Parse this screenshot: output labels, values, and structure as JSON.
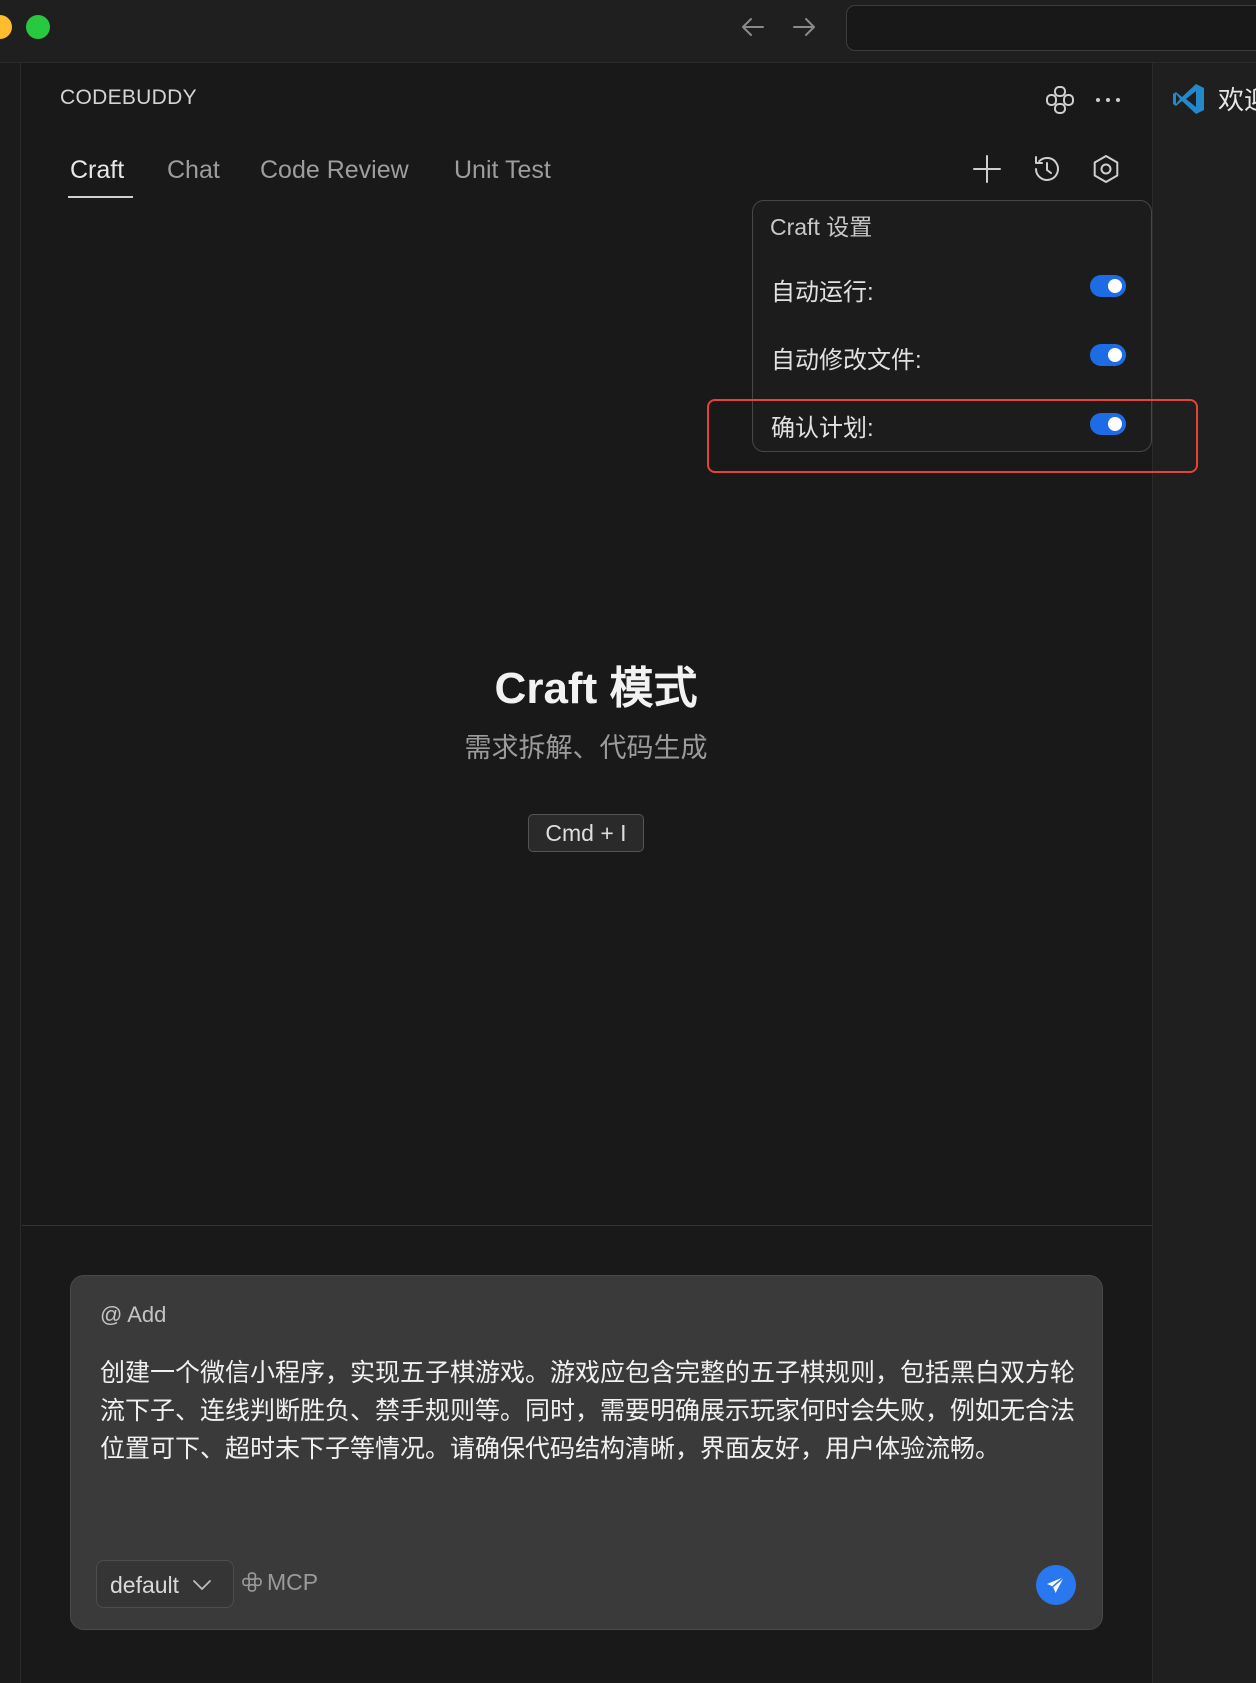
{
  "panel": {
    "title": "CODEBUDDY"
  },
  "tabs": [
    {
      "label": "Craft",
      "active": true
    },
    {
      "label": "Chat",
      "active": false
    },
    {
      "label": "Code Review",
      "active": false
    },
    {
      "label": "Unit Test",
      "active": false
    }
  ],
  "editor": {
    "welcome_tab_label": "欢迎"
  },
  "settings_popup": {
    "title": "Craft 设置",
    "items": [
      {
        "label": "自动运行:",
        "enabled": true
      },
      {
        "label": "自动修改文件:",
        "enabled": true
      },
      {
        "label": "确认计划:",
        "enabled": true
      }
    ]
  },
  "empty_state": {
    "title": "Craft 模式",
    "subtitle": "需求拆解、代码生成",
    "shortcut": "Cmd + I"
  },
  "composer": {
    "add_context_label": "@ Add",
    "prompt": "创建一个微信小程序，实现五子棋游戏。游戏应包含完整的五子棋规则，包括黑白双方轮流下子、连线判断胜负、禁手规则等。同时，需要明确展示玩家何时会失败，例如无合法位置可下、超时未下子等情况。请确保代码结构清晰，界面友好，用户体验流畅。",
    "model": "default",
    "mcp_label": "MCP"
  },
  "colors": {
    "accent": "#1e6be6",
    "highlight_border": "#e8413a",
    "traffic_yellow": "#febc2e",
    "traffic_green": "#28c840"
  },
  "icons": {
    "back": "arrow-left-icon",
    "forward": "arrow-right-icon",
    "logo": "codebuddy-logo-icon",
    "more": "ellipsis-icon",
    "new_chat": "plus-icon",
    "history": "history-icon",
    "settings": "settings-icon",
    "vscode": "vscode-icon",
    "send": "send-icon"
  }
}
